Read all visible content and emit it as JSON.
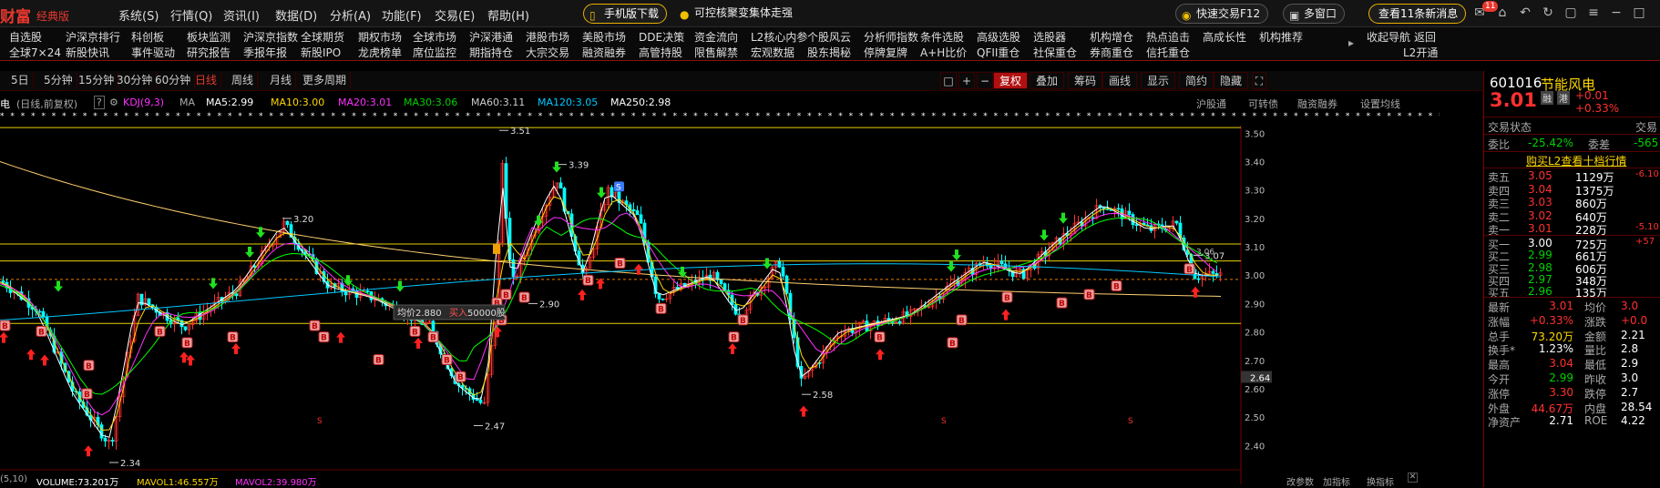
{
  "app": {
    "logo": "财富",
    "edition": "经典版"
  },
  "menu": [
    "系统(S)",
    "行情(Q)",
    "资讯(I)",
    "数据(D)",
    "分析(A)",
    "功能(F)",
    "交易(E)",
    "帮助(H)"
  ],
  "pills": {
    "mobile": "手机版下载",
    "promo": "可控核聚变集体走强",
    "fast_trade": "快速交易F12",
    "multi_window": "多窗口",
    "news": "查看11条新消息"
  },
  "badge": "11",
  "nav_row1": [
    "自选股",
    "沪深京排行",
    "科创板",
    "板块监测",
    "沪深京指数",
    "全球期货",
    "期权市场",
    "全球市场",
    "沪深港通",
    "港股市场",
    "美股市场",
    "DDE决策",
    "资金流向",
    "L2核心内参",
    "个股风云",
    "分析师指数",
    "条件选股",
    "高级选股",
    "选股器",
    "机构增仓",
    "热点追击",
    "高成长性",
    "机构推荐",
    "收起导航",
    "返回"
  ],
  "nav_row2": [
    "全球7×24",
    "新股快讯",
    "事件驱动",
    "研究报告",
    "季报年报",
    "新股IPO",
    "龙虎榜单",
    "席位监控",
    "期指持仓",
    "大宗交易",
    "融资融券",
    "高管持股",
    "限售解禁",
    "宏观数据",
    "股东揭秘",
    "停牌复牌",
    "A+H比价",
    "QFII重仓",
    "社保重仓",
    "券商重仓",
    "信托重仓",
    "L2开通"
  ],
  "nav_arrows": [
    "▾",
    "▸"
  ],
  "periods": [
    "5日",
    "5分钟",
    "15分钟",
    "30分钟",
    "60分钟",
    "日线",
    "周线",
    "月线",
    "更多周期"
  ],
  "active_period": "日线",
  "toolbar_right": [
    "复权",
    "叠加",
    "筹码",
    "画线",
    "显示",
    "简约",
    "隐藏"
  ],
  "toolbar_icons": [
    "□",
    "+",
    "−"
  ],
  "stock_short": "电",
  "ma_header": {
    "mode": "(日线,前复权)",
    "kdj": "KDJ(9,3)",
    "ma": "MA",
    "ma5": "MA5:2.99",
    "ma10": "MA10:3.00",
    "ma20": "MA20:3.01",
    "ma30": "MA30:3.06",
    "ma60": "MA60:3.11",
    "ma120": "MA120:3.05",
    "ma250": "MA250:2.98"
  },
  "links": [
    "沪股通",
    "可转债",
    "融资融券",
    "设置均线"
  ],
  "y_axis": [
    "3.50",
    "3.40",
    "3.30",
    "3.20",
    "3.10",
    "3.00",
    "2.90",
    "2.80",
    "2.70",
    "2.60",
    "2.50",
    "2.40"
  ],
  "current_marker": "2.64",
  "annotations": {
    "high": "3.51",
    "p339": "3.39",
    "p320": "3.20",
    "p290": "2.90",
    "p258": "2.58",
    "p247": "2.47",
    "p234": "2.34",
    "p307": "3.07",
    "p306": "3.06"
  },
  "tooltip": {
    "avg_label": "均价2.880",
    "action": "买入",
    "qty": "50000股"
  },
  "bottom": {
    "left": "(5,10)",
    "volume": "VOLUME:73.201万",
    "mavol1": "MAVOL1:46.557万",
    "mavol2": "MAVOL2:39.980万",
    "params": "改参数",
    "add_indicator": "加指标",
    "switch_indicator": "换指标"
  },
  "colors": {
    "ma5": "#ffffff",
    "ma10": "#ffd700",
    "ma20": "#ff30ff",
    "ma30": "#00ff00",
    "ma60": "#cccccc",
    "ma120": "#00c8ff",
    "ma250": "#ffd700",
    "up": "#ff3030",
    "down": "#00ffff"
  },
  "panel": {
    "code": "601016",
    "name": "节能风电",
    "tags": [
      "融",
      "港"
    ],
    "price": "3.01",
    "chg": "+0.01",
    "pct": "+0.33%",
    "status_label": "交易状态",
    "status_val": "交易",
    "wb_label": "委比",
    "wb_val": "-25.42%",
    "wc_label": "委差",
    "wc_val": "-565",
    "l2_link": "购买L2查看十档行情",
    "asks": [
      {
        "l": "卖五",
        "p": "3.05",
        "v": "1129万",
        "c": "-6.10"
      },
      {
        "l": "卖四",
        "p": "3.04",
        "v": "1375万",
        "c": ""
      },
      {
        "l": "卖三",
        "p": "3.03",
        "v": "860万",
        "c": ""
      },
      {
        "l": "卖二",
        "p": "3.02",
        "v": "640万",
        "c": ""
      },
      {
        "l": "卖一",
        "p": "3.01",
        "v": "228万",
        "c": "-5.10"
      }
    ],
    "bids": [
      {
        "l": "买一",
        "p": "3.00",
        "v": "725万",
        "c": "+57"
      },
      {
        "l": "买二",
        "p": "2.99",
        "v": "661万",
        "c": ""
      },
      {
        "l": "买三",
        "p": "2.98",
        "v": "606万",
        "c": ""
      },
      {
        "l": "买四",
        "p": "2.97",
        "v": "348万",
        "c": ""
      },
      {
        "l": "买五",
        "p": "2.96",
        "v": "135万",
        "c": ""
      }
    ],
    "stats": [
      {
        "a": "最新",
        "av": "3.01",
        "b": "均价",
        "bv": "3.0"
      },
      {
        "a": "涨幅",
        "av": "+0.33%",
        "b": "涨跌",
        "bv": "+0.0"
      },
      {
        "a": "总手",
        "av": "73.20万",
        "b": "金额",
        "bv": "2.21"
      },
      {
        "a": "换手*",
        "av": "1.23%",
        "b": "量比",
        "bv": "2.8"
      },
      {
        "a": "最高",
        "av": "3.04",
        "b": "最低",
        "bv": "2.9"
      },
      {
        "a": "今开",
        "av": "2.99",
        "b": "昨收",
        "bv": "3.0"
      },
      {
        "a": "涨停",
        "av": "3.30",
        "b": "跌停",
        "bv": "2.7"
      },
      {
        "a": "外盘",
        "av": "44.67万",
        "b": "内盘",
        "bv": "28.54"
      },
      {
        "a": "净资产",
        "av": "2.71",
        "b": "ROE",
        "bv": "4.22"
      }
    ]
  }
}
